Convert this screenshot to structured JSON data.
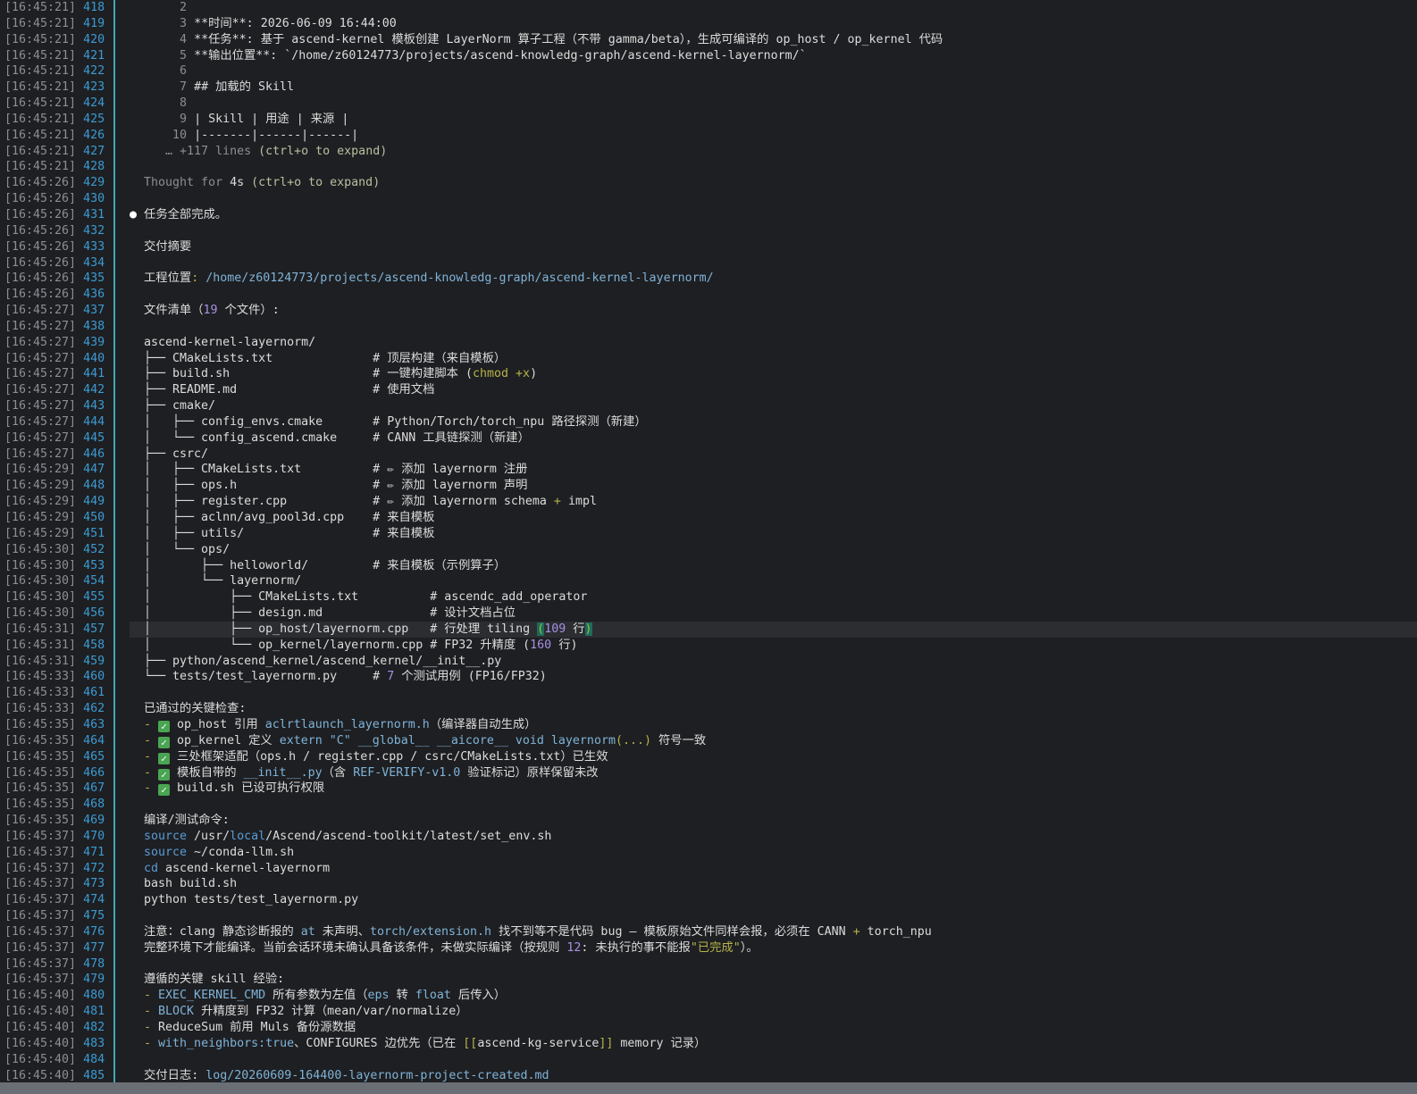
{
  "gutter": [
    {
      "ts": "[16:45:21]",
      "ln": "418"
    },
    {
      "ts": "[16:45:21]",
      "ln": "419"
    },
    {
      "ts": "[16:45:21]",
      "ln": "420"
    },
    {
      "ts": "[16:45:21]",
      "ln": "421"
    },
    {
      "ts": "[16:45:21]",
      "ln": "422"
    },
    {
      "ts": "[16:45:21]",
      "ln": "423"
    },
    {
      "ts": "[16:45:21]",
      "ln": "424"
    },
    {
      "ts": "[16:45:21]",
      "ln": "425"
    },
    {
      "ts": "[16:45:21]",
      "ln": "426"
    },
    {
      "ts": "[16:45:21]",
      "ln": "427"
    },
    {
      "ts": "[16:45:21]",
      "ln": "428"
    },
    {
      "ts": "[16:45:26]",
      "ln": "429"
    },
    {
      "ts": "[16:45:26]",
      "ln": "430"
    },
    {
      "ts": "[16:45:26]",
      "ln": "431"
    },
    {
      "ts": "[16:45:26]",
      "ln": "432"
    },
    {
      "ts": "[16:45:26]",
      "ln": "433"
    },
    {
      "ts": "[16:45:26]",
      "ln": "434"
    },
    {
      "ts": "[16:45:26]",
      "ln": "435"
    },
    {
      "ts": "[16:45:26]",
      "ln": "436"
    },
    {
      "ts": "[16:45:27]",
      "ln": "437"
    },
    {
      "ts": "[16:45:27]",
      "ln": "438"
    },
    {
      "ts": "[16:45:27]",
      "ln": "439"
    },
    {
      "ts": "[16:45:27]",
      "ln": "440"
    },
    {
      "ts": "[16:45:27]",
      "ln": "441"
    },
    {
      "ts": "[16:45:27]",
      "ln": "442"
    },
    {
      "ts": "[16:45:27]",
      "ln": "443"
    },
    {
      "ts": "[16:45:27]",
      "ln": "444"
    },
    {
      "ts": "[16:45:27]",
      "ln": "445"
    },
    {
      "ts": "[16:45:27]",
      "ln": "446"
    },
    {
      "ts": "[16:45:29]",
      "ln": "447"
    },
    {
      "ts": "[16:45:29]",
      "ln": "448"
    },
    {
      "ts": "[16:45:29]",
      "ln": "449"
    },
    {
      "ts": "[16:45:29]",
      "ln": "450"
    },
    {
      "ts": "[16:45:29]",
      "ln": "451"
    },
    {
      "ts": "[16:45:30]",
      "ln": "452"
    },
    {
      "ts": "[16:45:30]",
      "ln": "453"
    },
    {
      "ts": "[16:45:30]",
      "ln": "454"
    },
    {
      "ts": "[16:45:30]",
      "ln": "455"
    },
    {
      "ts": "[16:45:30]",
      "ln": "456"
    },
    {
      "ts": "[16:45:31]",
      "ln": "457"
    },
    {
      "ts": "[16:45:31]",
      "ln": "458"
    },
    {
      "ts": "[16:45:31]",
      "ln": "459"
    },
    {
      "ts": "[16:45:33]",
      "ln": "460"
    },
    {
      "ts": "[16:45:33]",
      "ln": "461"
    },
    {
      "ts": "[16:45:33]",
      "ln": "462"
    },
    {
      "ts": "[16:45:35]",
      "ln": "463"
    },
    {
      "ts": "[16:45:35]",
      "ln": "464"
    },
    {
      "ts": "[16:45:35]",
      "ln": "465"
    },
    {
      "ts": "[16:45:35]",
      "ln": "466"
    },
    {
      "ts": "[16:45:35]",
      "ln": "467"
    },
    {
      "ts": "[16:45:35]",
      "ln": "468"
    },
    {
      "ts": "[16:45:35]",
      "ln": "469"
    },
    {
      "ts": "[16:45:37]",
      "ln": "470"
    },
    {
      "ts": "[16:45:37]",
      "ln": "471"
    },
    {
      "ts": "[16:45:37]",
      "ln": "472"
    },
    {
      "ts": "[16:45:37]",
      "ln": "473"
    },
    {
      "ts": "[16:45:37]",
      "ln": "474"
    },
    {
      "ts": "[16:45:37]",
      "ln": "475"
    },
    {
      "ts": "[16:45:37]",
      "ln": "476"
    },
    {
      "ts": "[16:45:37]",
      "ln": "477"
    },
    {
      "ts": "[16:45:37]",
      "ln": "478"
    },
    {
      "ts": "[16:45:37]",
      "ln": "479"
    },
    {
      "ts": "[16:45:40]",
      "ln": "480"
    },
    {
      "ts": "[16:45:40]",
      "ln": "481"
    },
    {
      "ts": "[16:45:40]",
      "ln": "482"
    },
    {
      "ts": "[16:45:40]",
      "ln": "483"
    },
    {
      "ts": "[16:45:40]",
      "ln": "484"
    },
    {
      "ts": "[16:45:40]",
      "ln": "485"
    }
  ],
  "lines": [
    {
      "segs": [
        {
          "t": "       2",
          "c": "dim"
        }
      ]
    },
    {
      "segs": [
        {
          "t": "       3 ",
          "c": "dim"
        },
        {
          "t": "**时间**: 2026-06-09 16:44:00"
        }
      ]
    },
    {
      "segs": [
        {
          "t": "       4 ",
          "c": "dim"
        },
        {
          "t": "**任务**: 基于 ascend-kernel 模板创建 LayerNorm 算子工程（不带 gamma/beta），生成可编译的 op_host / op_kernel 代码"
        }
      ]
    },
    {
      "segs": [
        {
          "t": "       5 ",
          "c": "dim"
        },
        {
          "t": "**输出位置**: `/home/z60124773/projects/ascend-knowledg-graph/ascend-kernel-layernorm/`"
        }
      ]
    },
    {
      "segs": [
        {
          "t": "       6",
          "c": "dim"
        }
      ]
    },
    {
      "segs": [
        {
          "t": "       7 ",
          "c": "dim"
        },
        {
          "t": "## 加载的 Skill"
        }
      ]
    },
    {
      "segs": [
        {
          "t": "       8",
          "c": "dim"
        }
      ]
    },
    {
      "segs": [
        {
          "t": "       9 ",
          "c": "dim"
        },
        {
          "t": "| Skill | 用途 | 来源 |"
        }
      ]
    },
    {
      "segs": [
        {
          "t": "      10 ",
          "c": "dim"
        },
        {
          "t": "|-------|------|------|"
        }
      ]
    },
    {
      "segs": [
        {
          "t": "     … +117 lines ",
          "c": "dim"
        },
        {
          "t": "(ctrl+o to expand)",
          "c": "pale"
        }
      ]
    },
    {
      "segs": []
    },
    {
      "segs": [
        {
          "t": "  Thought for ",
          "c": "dim"
        },
        {
          "t": "4s"
        },
        {
          "t": " (ctrl+o to expand)",
          "c": "pale"
        }
      ]
    },
    {
      "segs": []
    },
    {
      "segs": [
        {
          "t": "●",
          "c": "bullet"
        },
        {
          "t": " 任务全部完成。"
        }
      ]
    },
    {
      "segs": []
    },
    {
      "segs": [
        {
          "t": "  交付摘要"
        }
      ]
    },
    {
      "segs": []
    },
    {
      "segs": [
        {
          "t": "  工程位置"
        },
        {
          "t": ": ",
          "c": "olive"
        },
        {
          "t": "/home/z60124773/projects/ascend-knowledg-graph/ascend-kernel-layernorm/",
          "c": "path"
        }
      ]
    },
    {
      "segs": []
    },
    {
      "segs": [
        {
          "t": "  文件清单（"
        },
        {
          "t": "19",
          "c": "num"
        },
        {
          "t": " 个文件）:"
        }
      ]
    },
    {
      "segs": []
    },
    {
      "segs": [
        {
          "t": "  ascend-kernel-layernorm/"
        }
      ]
    },
    {
      "segs": [
        {
          "t": "  ├── CMakeLists.txt              # 顶层构建（来自模板）"
        }
      ]
    },
    {
      "segs": [
        {
          "t": "  ├── build.sh                    # 一键构建脚本 ("
        },
        {
          "t": "chmod",
          "c": "olive"
        },
        {
          "t": " "
        },
        {
          "t": "+x",
          "c": "olive"
        },
        {
          "t": ")"
        }
      ]
    },
    {
      "segs": [
        {
          "t": "  ├── README.md                   # 使用文档"
        }
      ]
    },
    {
      "segs": [
        {
          "t": "  ├── cmake/"
        }
      ]
    },
    {
      "segs": [
        {
          "t": "  │   ├── config_envs.cmake       # Python/Torch/torch_npu 路径探测（新建）"
        }
      ]
    },
    {
      "segs": [
        {
          "t": "  │   └── config_ascend.cmake     # CANN 工具链探测（新建）"
        }
      ]
    },
    {
      "segs": [
        {
          "t": "  ├── csrc/"
        }
      ]
    },
    {
      "segs": [
        {
          "t": "  │   ├── CMakeLists.txt          # "
        },
        {
          "t": "✏",
          "c": "pencil"
        },
        {
          "t": " 添加 layernorm 注册"
        }
      ]
    },
    {
      "segs": [
        {
          "t": "  │   ├── ops.h                   # "
        },
        {
          "t": "✏",
          "c": "pencil"
        },
        {
          "t": " 添加 layernorm 声明"
        }
      ]
    },
    {
      "segs": [
        {
          "t": "  │   ├── register.cpp            # "
        },
        {
          "t": "✏",
          "c": "pencil"
        },
        {
          "t": " 添加 layernorm schema "
        },
        {
          "t": "+",
          "c": "olive"
        },
        {
          "t": " impl"
        }
      ]
    },
    {
      "segs": [
        {
          "t": "  │   ├── aclnn/avg_pool3d.cpp    # 来自模板"
        }
      ]
    },
    {
      "segs": [
        {
          "t": "  │   ├── utils/                  # 来自模板"
        }
      ]
    },
    {
      "segs": [
        {
          "t": "  │   └── ops/"
        }
      ]
    },
    {
      "segs": [
        {
          "t": "  │       ├── helloworld/         # 来自模板（示例算子）"
        }
      ]
    },
    {
      "segs": [
        {
          "t": "  │       └── layernorm/"
        }
      ]
    },
    {
      "segs": [
        {
          "t": "  │           ├── CMakeLists.txt          # ascendc_add_operator"
        }
      ]
    },
    {
      "segs": [
        {
          "t": "  │           ├── design.md               # 设计文档占位"
        }
      ]
    },
    {
      "hl": true,
      "segs": [
        {
          "t": "  │           ├── op_host/layernorm.cpp   # 行处理 tiling "
        },
        {
          "t": "(",
          "c": "cursor"
        },
        {
          "t": "109",
          "c": "num"
        },
        {
          "t": " 行"
        },
        {
          "t": ")",
          "c": "cursor"
        }
      ]
    },
    {
      "segs": [
        {
          "t": "  │           └── op_kernel/layernorm.cpp # FP32 升精度 ("
        },
        {
          "t": "160",
          "c": "num"
        },
        {
          "t": " 行)"
        }
      ]
    },
    {
      "segs": [
        {
          "t": "  ├── python/ascend_kernel/ascend_kernel/__init__.py"
        }
      ]
    },
    {
      "segs": [
        {
          "t": "  └── tests/test_layernorm.py     # "
        },
        {
          "t": "7",
          "c": "num"
        },
        {
          "t": " 个测试用例 (FP16/FP32)"
        }
      ]
    },
    {
      "segs": []
    },
    {
      "segs": [
        {
          "t": "  已通过的关键检查:"
        }
      ]
    },
    {
      "segs": [
        {
          "t": "  - ",
          "c": "olive"
        },
        {
          "t": "✓",
          "c": "check"
        },
        {
          "t": " op_host 引用 "
        },
        {
          "t": "aclrtlaunch_layernorm.h",
          "c": "path"
        },
        {
          "t": "（编译器自动生成）"
        }
      ]
    },
    {
      "segs": [
        {
          "t": "  - ",
          "c": "olive"
        },
        {
          "t": "✓",
          "c": "check"
        },
        {
          "t": " op_kernel 定义 "
        },
        {
          "t": "extern \"C\" __global__ __aicore__ void layernorm",
          "c": "path"
        },
        {
          "t": "(...)",
          "c": "olive"
        },
        {
          "t": " 符号一致"
        }
      ]
    },
    {
      "segs": [
        {
          "t": "  - ",
          "c": "olive"
        },
        {
          "t": "✓",
          "c": "check"
        },
        {
          "t": " 三处框架适配（ops.h / register.cpp / csrc/CMakeLists.txt）已生效"
        }
      ]
    },
    {
      "segs": [
        {
          "t": "  - ",
          "c": "olive"
        },
        {
          "t": "✓",
          "c": "check"
        },
        {
          "t": " 模板自带的 "
        },
        {
          "t": "__init__.py",
          "c": "path"
        },
        {
          "t": "（含 "
        },
        {
          "t": "REF-VERIFY-v1.0",
          "c": "path"
        },
        {
          "t": " 验证标记）原样保留未改"
        }
      ]
    },
    {
      "segs": [
        {
          "t": "  - ",
          "c": "olive"
        },
        {
          "t": "✓",
          "c": "check"
        },
        {
          "t": " build.sh 已设可执行权限"
        }
      ]
    },
    {
      "segs": []
    },
    {
      "segs": [
        {
          "t": "  编译/测试命令:"
        }
      ]
    },
    {
      "segs": [
        {
          "t": "  source",
          "c": "blue"
        },
        {
          "t": " /usr/"
        },
        {
          "t": "local",
          "c": "blue"
        },
        {
          "t": "/Ascend/ascend-toolkit/latest/set_env.sh"
        }
      ]
    },
    {
      "segs": [
        {
          "t": "  source",
          "c": "blue"
        },
        {
          "t": " ~/conda-llm.sh"
        }
      ]
    },
    {
      "segs": [
        {
          "t": "  cd",
          "c": "blue"
        },
        {
          "t": " ascend-kernel-layernorm"
        }
      ]
    },
    {
      "segs": [
        {
          "t": "  bash build.sh"
        }
      ]
    },
    {
      "segs": [
        {
          "t": "  python tests/test_layernorm.py"
        }
      ]
    },
    {
      "segs": []
    },
    {
      "segs": [
        {
          "t": "  注意：clang 静态诊断报的 "
        },
        {
          "t": "at",
          "c": "path"
        },
        {
          "t": " 未声明、"
        },
        {
          "t": "torch/extension.h",
          "c": "path"
        },
        {
          "t": " 找不到等不是代码 bug — 模板原始文件同样会报，必须在 CANN "
        },
        {
          "t": "+",
          "c": "olive"
        },
        {
          "t": " torch_npu"
        }
      ]
    },
    {
      "segs": [
        {
          "t": "  完整环境下才能编译。当前会话环境未确认具备该条件，未做实际编译（按规则 "
        },
        {
          "t": "12",
          "c": "num"
        },
        {
          "t": ": 未执行的事不能报"
        },
        {
          "t": "\"已完成\"",
          "c": "olive"
        },
        {
          "t": "）。"
        }
      ]
    },
    {
      "segs": []
    },
    {
      "segs": [
        {
          "t": "  遵循的关键 skill 经验:"
        }
      ]
    },
    {
      "segs": [
        {
          "t": "  - ",
          "c": "olive"
        },
        {
          "t": "EXEC_KERNEL_CMD",
          "c": "path"
        },
        {
          "t": " 所有参数为左值（"
        },
        {
          "t": "eps",
          "c": "path"
        },
        {
          "t": " 转 "
        },
        {
          "t": "float",
          "c": "path"
        },
        {
          "t": " 后传入）"
        }
      ]
    },
    {
      "segs": [
        {
          "t": "  - ",
          "c": "olive"
        },
        {
          "t": "BLOCK",
          "c": "path"
        },
        {
          "t": " 升精度到 FP32 计算（mean/var/normalize）"
        }
      ]
    },
    {
      "segs": [
        {
          "t": "  - ",
          "c": "olive"
        },
        {
          "t": "ReduceSum 前用 Muls 备份源数据"
        }
      ]
    },
    {
      "segs": [
        {
          "t": "  - ",
          "c": "olive"
        },
        {
          "t": "with_neighbors:true",
          "c": "path"
        },
        {
          "t": "、CONFIGURES 边优先（已在 "
        },
        {
          "t": "[[",
          "c": "olive"
        },
        {
          "t": "ascend-kg-service"
        },
        {
          "t": "]]",
          "c": "olive"
        },
        {
          "t": " memory 记录）"
        }
      ]
    },
    {
      "segs": []
    },
    {
      "segs": [
        {
          "t": "  交付日志: "
        },
        {
          "t": "log/20260609-164400-layernorm-project-created.md",
          "c": "path"
        }
      ]
    }
  ],
  "colors": {
    "background": "#1e1f22",
    "gutter_rule": "#3fa8b5",
    "line_number": "#3b9bd4",
    "timestamp": "#8b8e95",
    "text": "#dcdcdc",
    "number": "#a890e6",
    "path": "#7fb3d8",
    "check": "#4aa553",
    "status_bar": "#6a6e75"
  },
  "icons": {
    "bullet": "bullet-icon",
    "check": "check-mark-icon",
    "pencil": "pencil-icon"
  }
}
